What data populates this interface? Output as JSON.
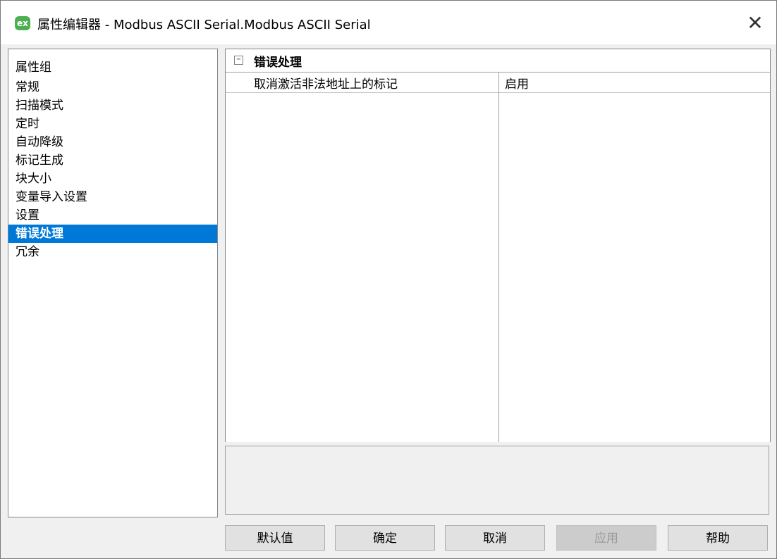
{
  "window": {
    "icon_text": "ex",
    "title": "属性编辑器 - Modbus ASCII Serial.Modbus ASCII Serial",
    "close_glyph": "✕"
  },
  "property_groups": {
    "header": "属性组",
    "items": [
      "常规",
      "扫描模式",
      "定时",
      "自动降级",
      "标记生成",
      "块大小",
      "变量导入设置",
      "设置",
      "错误处理",
      "冗余"
    ],
    "selected": "错误处理"
  },
  "grid": {
    "category": {
      "collapse_glyph": "−",
      "label": "错误处理"
    },
    "rows": [
      {
        "name": "取消激活非法地址上的标记",
        "value": "启用"
      }
    ]
  },
  "buttons": {
    "default": "默认值",
    "ok": "确定",
    "cancel": "取消",
    "apply": "应用",
    "help": "帮助"
  },
  "colors": {
    "selection": "#0078d7",
    "icon": "#4caf50"
  }
}
